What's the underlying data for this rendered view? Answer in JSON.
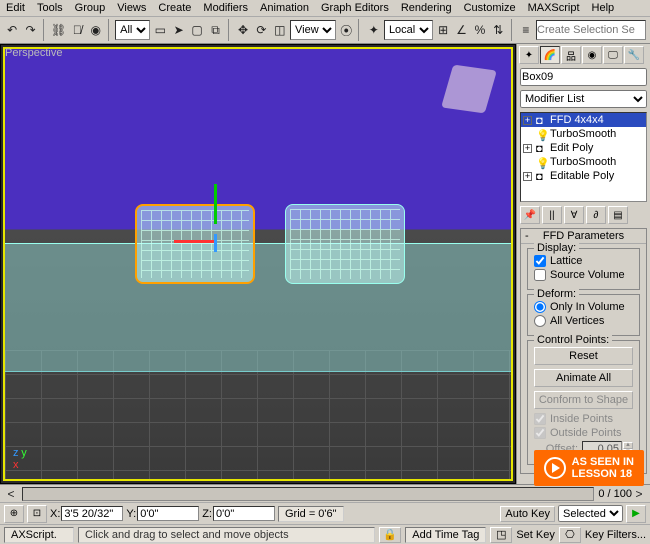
{
  "menu": {
    "items": [
      "Edit",
      "Tools",
      "Group",
      "Views",
      "Create",
      "Modifiers",
      "Animation",
      "Graph Editors",
      "Rendering",
      "Customize",
      "MAXScript",
      "Help"
    ]
  },
  "toolbar": {
    "selset_placeholder": "Create Selection Se",
    "all_label": "All",
    "view_label": "View",
    "local_label": "Local"
  },
  "viewport": {
    "label": "Perspective"
  },
  "cmd": {
    "object_name": "Box09",
    "modlist_label": "Modifier List",
    "stack": [
      {
        "label": "FFD 4x4x4",
        "selected": true
      },
      {
        "label": "TurboSmooth",
        "selected": false
      },
      {
        "label": "Edit Poly",
        "selected": false
      },
      {
        "label": "TurboSmooth",
        "selected": false
      },
      {
        "label": "Editable Poly",
        "selected": false
      }
    ],
    "rollout_title": "FFD Parameters",
    "display": {
      "legend": "Display:",
      "lattice": "Lattice",
      "source": "Source Volume",
      "lattice_on": true,
      "source_on": false
    },
    "deform": {
      "legend": "Deform:",
      "only": "Only In Volume",
      "all": "All Vertices",
      "choice": "only"
    },
    "ctrl": {
      "legend": "Control Points:",
      "reset": "Reset",
      "animate": "Animate All",
      "conform": "Conform to Shape",
      "inside": "Inside Points",
      "outside": "Outside Points",
      "inside_on": true,
      "outside_on": true,
      "offset_label": "Offset:",
      "offset_val": "0.05"
    }
  },
  "timeline": {
    "frame": "0 / 100"
  },
  "coord": {
    "x": "3'5 20/32\"",
    "y": "0'0\"",
    "z": "0'0\"",
    "grid_label": "Grid = 0'6\"",
    "autokey": "Auto Key",
    "mode": "Selected",
    "setkey": "Set Key",
    "keyfilters": "Key Filters..."
  },
  "status": {
    "script": "AXScript.",
    "prompt": "Click and drag to select and move objects",
    "addtag": "Add Time Tag"
  },
  "watermark": {
    "text1": "AS SEEN IN",
    "text2": "LESSON 18"
  }
}
